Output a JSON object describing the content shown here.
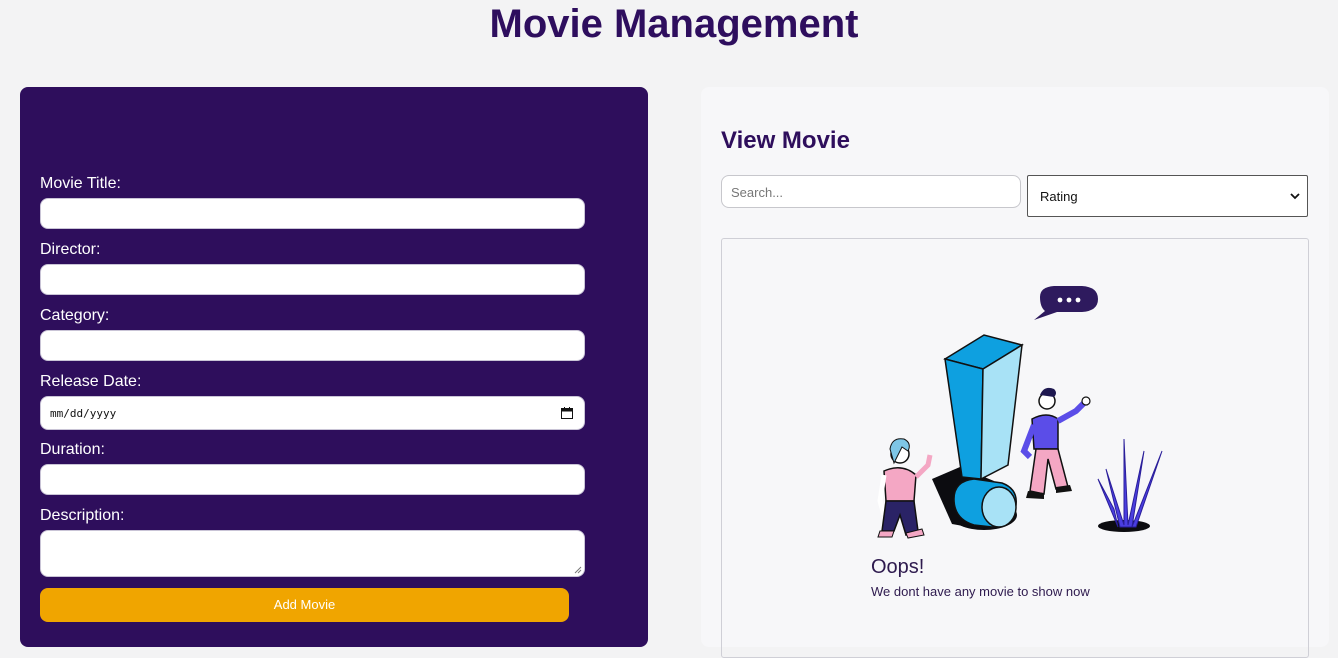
{
  "header": {
    "title": "Movie Management"
  },
  "form": {
    "fields": {
      "title_label": "Movie Title:",
      "title_value": "",
      "director_label": "Director:",
      "director_value": "",
      "category_label": "Category:",
      "category_value": "",
      "release_label": "Release Date:",
      "release_placeholder": "mm/dd/yyyy",
      "duration_label": "Duration:",
      "duration_value": "",
      "description_label": "Description:",
      "description_value": ""
    },
    "submit_label": "Add Movie"
  },
  "view": {
    "title": "View Movie",
    "search": {
      "placeholder": "Search...",
      "value": ""
    },
    "sort": {
      "selected": "Rating"
    },
    "empty_state": {
      "title": "Oops!",
      "message": "We dont have any movie to show now"
    }
  },
  "colors": {
    "brand": "#2e0e5c",
    "accent": "#f0a500",
    "background": "#f3f3f4"
  }
}
